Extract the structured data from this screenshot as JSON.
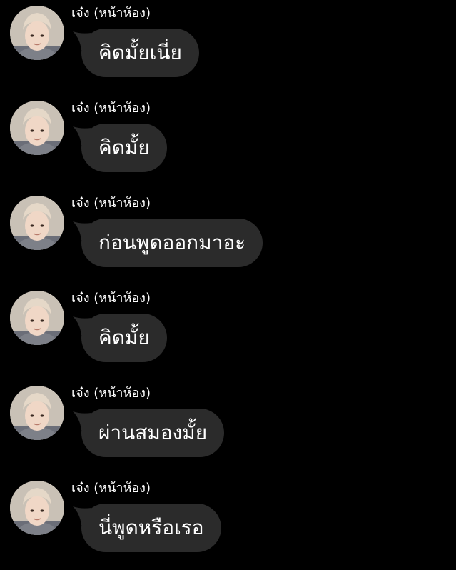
{
  "messages": [
    {
      "sender": "เจ๋ง (หน้าห้อง)",
      "text": "คิดมั้ยเนี่ย"
    },
    {
      "sender": "เจ๋ง (หน้าห้อง)",
      "text": "คิดมั้ย"
    },
    {
      "sender": "เจ๋ง (หน้าห้อง)",
      "text": "ก่อนพูดออกมาอะ"
    },
    {
      "sender": "เจ๋ง (หน้าห้อง)",
      "text": "คิดมั้ย"
    },
    {
      "sender": "เจ๋ง (หน้าห้อง)",
      "text": "ผ่านสมองมั้ย"
    },
    {
      "sender": "เจ๋ง (หน้าห้อง)",
      "text": "นี่พูดหรือเรอ"
    }
  ],
  "colors": {
    "background": "#000000",
    "bubble": "#2b2b2b",
    "text": "#ffffff"
  }
}
